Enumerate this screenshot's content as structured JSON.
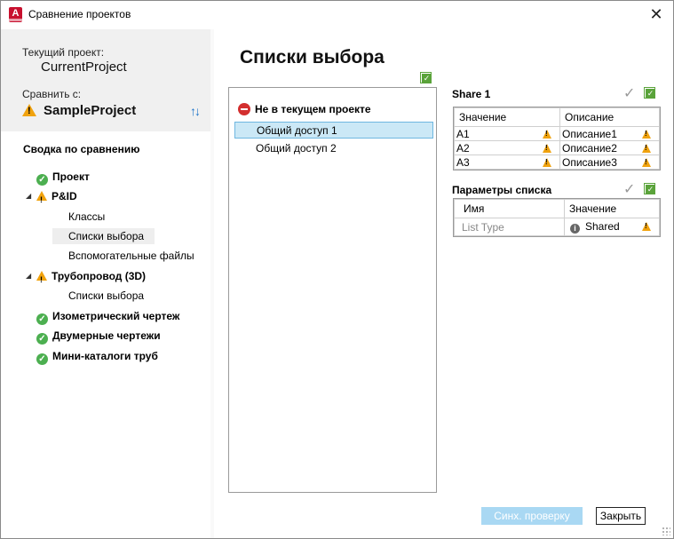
{
  "window": {
    "title": "Сравнение проектов",
    "app_icon_letter": "A",
    "close_glyph": "✕"
  },
  "sidebar": {
    "current_label": "Текущий проект:",
    "current_value": "CurrentProject",
    "compare_label": "Сравнить с:",
    "compare_value": "SampleProject",
    "summary_title": "Сводка по сравнению",
    "tree": [
      {
        "label": "Проект",
        "status": "ok"
      },
      {
        "label": "P&ID",
        "status": "warn"
      },
      {
        "label": "Классы",
        "status": "none"
      },
      {
        "label": "Списки выбора",
        "status": "none",
        "selected": true
      },
      {
        "label": "Вспомогательные файлы",
        "status": "none"
      },
      {
        "label": "Трубопровод (3D)",
        "status": "warn"
      },
      {
        "label": "Списки выбора",
        "status": "none"
      },
      {
        "label": "Изометрический чертеж",
        "status": "ok"
      },
      {
        "label": "Двумерные чертежи",
        "status": "ok"
      },
      {
        "label": "Мини-каталоги труб",
        "status": "ok"
      }
    ]
  },
  "main": {
    "title": "Списки выбора",
    "list": {
      "header": "Не в текущем проекте",
      "items": [
        "Общий доступ 1",
        "Общий доступ 2"
      ]
    },
    "share": {
      "title": "Share 1",
      "columns": [
        "Значение",
        "Описание"
      ],
      "rows": [
        [
          "A1",
          "Описание1"
        ],
        [
          "A2",
          "Описание2"
        ],
        [
          "A3",
          "Описание3"
        ]
      ]
    },
    "params": {
      "title": "Параметры списка",
      "columns": [
        "Имя",
        "Значение"
      ],
      "rows": [
        [
          "List Type",
          "Shared"
        ]
      ]
    }
  },
  "buttons": {
    "sync": "Синх. проверку",
    "close": "Закрыть"
  },
  "colors": {
    "ok": "#4caf50",
    "warn": "#f0a20d",
    "selected_row": "#cbe8f6",
    "sync_button": "#a9d8f3",
    "no_entry": "#d32f2f"
  }
}
